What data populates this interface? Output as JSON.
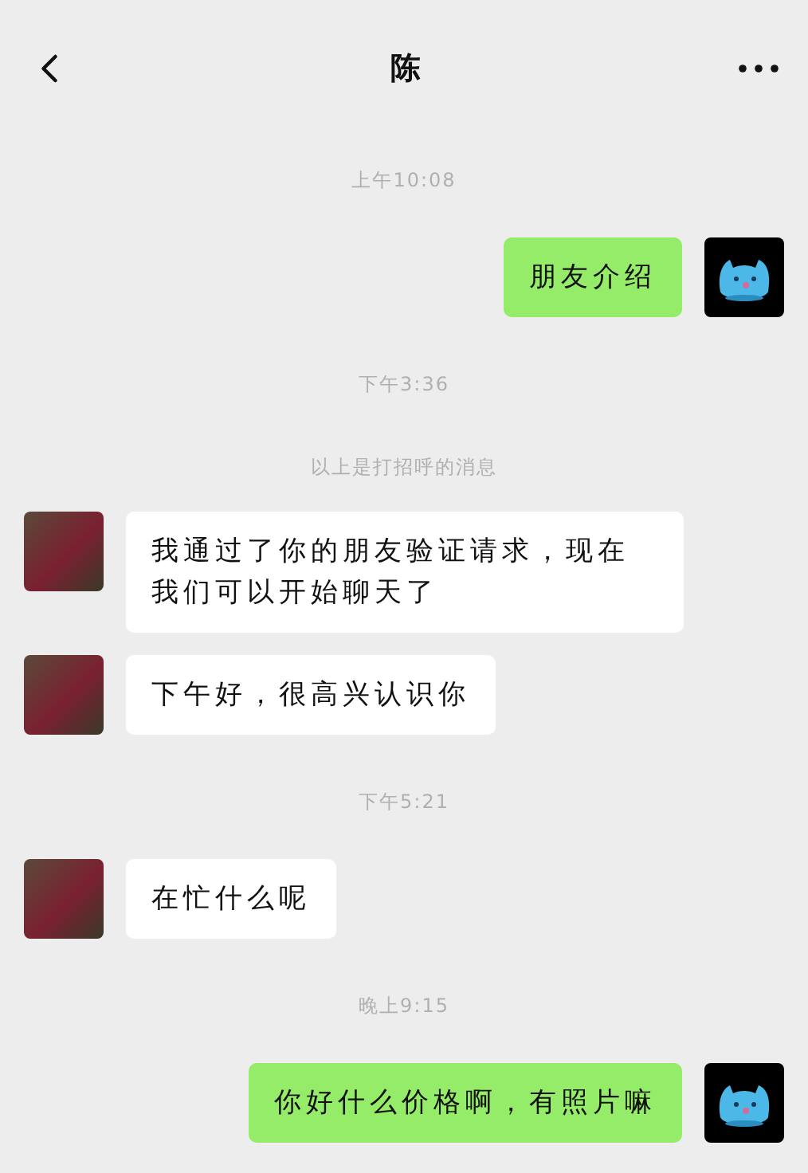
{
  "header": {
    "title": "陈"
  },
  "messages": [
    {
      "kind": "timestamp",
      "text": "上午10:08"
    },
    {
      "kind": "sent",
      "text": "朋友介绍"
    },
    {
      "kind": "timestamp",
      "text": "下午3:36"
    },
    {
      "kind": "notice",
      "text": "以上是打招呼的消息"
    },
    {
      "kind": "received",
      "text": "我通过了你的朋友验证请求，现在我们可以开始聊天了"
    },
    {
      "kind": "received",
      "text": "下午好，很高兴认识你"
    },
    {
      "kind": "timestamp",
      "text": "下午5:21"
    },
    {
      "kind": "received",
      "text": "在忙什么呢"
    },
    {
      "kind": "timestamp",
      "text": "晚上9:15"
    },
    {
      "kind": "sent",
      "text": "你好什么价格啊，有照片嘛"
    }
  ]
}
